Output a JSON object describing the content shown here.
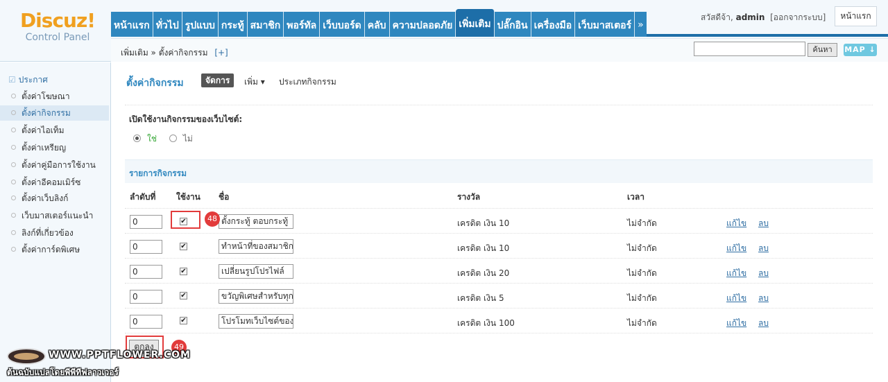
{
  "logo": {
    "main": "Discuz!",
    "sub": "Control Panel"
  },
  "topnav": {
    "items": [
      "หน้าแรก",
      "ทั่วไป",
      "รูปแบบ",
      "กระทู้",
      "สมาชิก",
      "พอร์ทัล",
      "เว็บบอร์ด",
      "คลับ",
      "ความปลอดภัย",
      "เพิ่มเติม",
      "ปลั๊กอิน",
      "เครื่องมือ",
      "เว็บมาสเตอร์"
    ],
    "active_index": 9,
    "more": "»"
  },
  "user": {
    "greeting": "สวัสดีจ้า,",
    "name": "admin",
    "logout": "[ออกจากระบบ]",
    "home": "หน้าแรก"
  },
  "breadcrumb": {
    "path": "เพิ่มเติม » ตั้งค่ากิจกรรม",
    "plus": "[+]"
  },
  "search": {
    "button": "ค้นหา",
    "map": "MAP ↓"
  },
  "sidebar": {
    "head": "ประกาศ",
    "items": [
      "ตั้งค่าโฆษณา",
      "ตั้งค่ากิจกรรม",
      "ตั้งค่าไอเท็ม",
      "ตั้งค่าเหรียญ",
      "ตั้งค่าคู่มือการใช้งาน",
      "ตั้งค่าอีคอมเมิร์ซ",
      "ตั้งค่าเว็บลิงก์",
      "เว็บมาสเตอร์แนะนำ",
      "ลิงก์ที่เกี่ยวข้อง",
      "ตั้งค่าการ์ดพิเศษ"
    ],
    "active_index": 1
  },
  "content": {
    "title": "ตั้งค่ากิจกรรม",
    "tab_manage": "จัดการ",
    "tab_more": "เพิ่ม ▾",
    "tab_types": "ประเภทกิจกรรม",
    "enable_label": "เปิดใช้งานกิจกรรมของเว็บไซต์:",
    "yes": "ใช่",
    "no": "ไม่",
    "section": "รายการกิจกรรม",
    "headers": {
      "order": "ลำดับที่",
      "enabled": "ใช้งาน",
      "name": "ชื่อ",
      "reward": "รางวัล",
      "time": "เวลา"
    },
    "rows": [
      {
        "order": "0",
        "name": "ตั้งกระทู้ ตอบกระทู้",
        "reward": "เครดิต เงิน 10",
        "time": "ไม่จำกัด",
        "edit": "แก้ไข",
        "del": "ลบ"
      },
      {
        "order": "0",
        "name": "ทำหน้าที่ของสมาชิก",
        "reward": "เครดิต เงิน 10",
        "time": "ไม่จำกัด",
        "edit": "แก้ไข",
        "del": "ลบ"
      },
      {
        "order": "0",
        "name": "เปลี่ยนรูปโปรไฟล์",
        "reward": "เครดิต เงิน 20",
        "time": "ไม่จำกัด",
        "edit": "แก้ไข",
        "del": "ลบ"
      },
      {
        "order": "0",
        "name": "ขวัญพิเศษสำหรับทุก",
        "reward": "เครดิต เงิน 5",
        "time": "ไม่จำกัด",
        "edit": "แก้ไข",
        "del": "ลบ"
      },
      {
        "order": "0",
        "name": "โปรโมทเว็บไซต์ของ",
        "reward": "เครดิต เงิน 100",
        "time": "ไม่จำกัด",
        "edit": "แก้ไข",
        "del": "ลบ"
      }
    ],
    "submit": "ตกลง"
  },
  "callouts": [
    "48",
    "49"
  ],
  "watermark": {
    "url": "WWW.PPTFLOWER.COM",
    "sub": "ต้นฉบับแปลโดยพีพีทีฟลาวเวอร์"
  },
  "colors": {
    "nav": "#2f87bf",
    "nav_active": "#1d6ea8",
    "callout": "#e23b3b"
  }
}
